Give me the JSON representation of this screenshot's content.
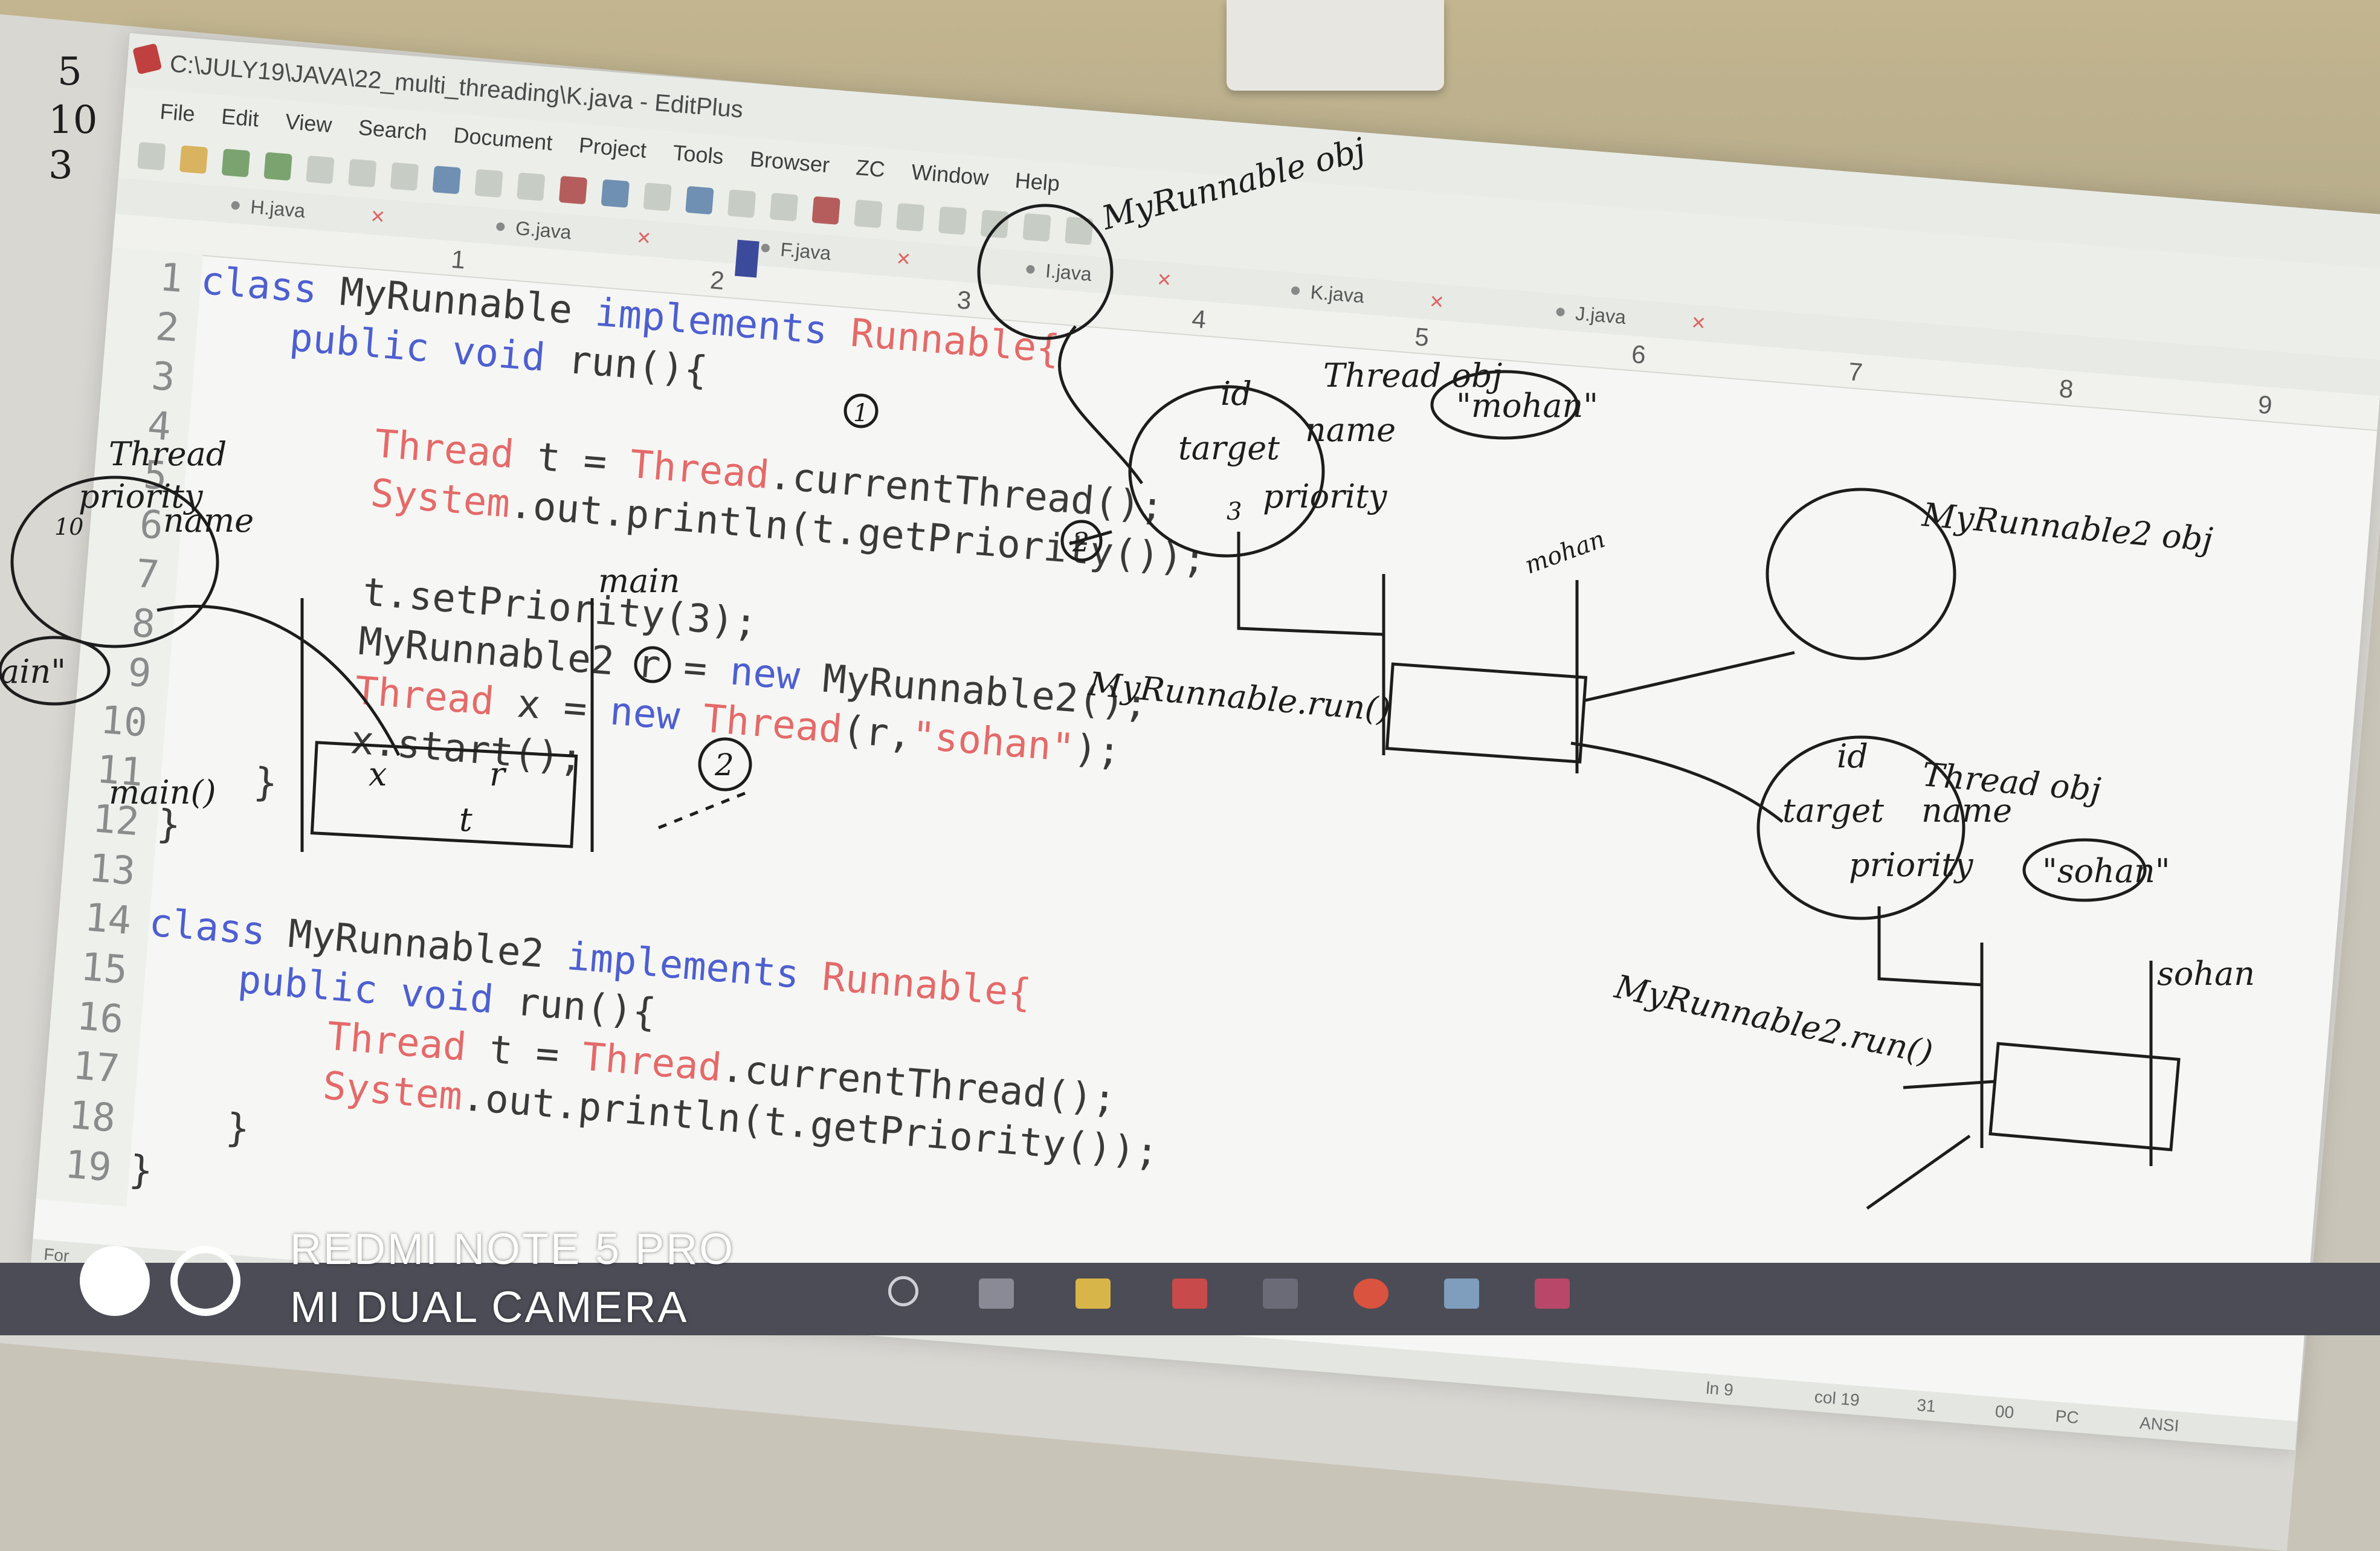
{
  "window": {
    "title": "C:\\JULY19\\JAVA\\22_multi_threading\\K.java - EditPlus"
  },
  "menu": {
    "items": [
      "File",
      "Edit",
      "View",
      "Search",
      "Document",
      "Project",
      "Tools",
      "Browser",
      "ZC",
      "Window",
      "Help"
    ]
  },
  "tabs": [
    "H.java",
    "G.java",
    "F.java",
    "I.java",
    "K.java",
    "J.java"
  ],
  "ruler": {
    "ticks": [
      "1",
      "2",
      "3",
      "4",
      "5",
      "6",
      "7",
      "8",
      "9"
    ]
  },
  "code": {
    "lines": [
      {
        "n": "1",
        "parts": [
          [
            "kw",
            "class "
          ],
          [
            "tx",
            "MyRunnable "
          ],
          [
            "kw",
            "implements "
          ],
          [
            "tp",
            "Runnable{"
          ]
        ]
      },
      {
        "n": "2",
        "parts": [
          [
            "kw",
            "    public void "
          ],
          [
            "tx",
            "run(){"
          ]
        ]
      },
      {
        "n": "3",
        "parts": []
      },
      {
        "n": "4",
        "parts": [
          [
            "tp",
            "        Thread "
          ],
          [
            "tx",
            "t = "
          ],
          [
            "tp",
            "Thread"
          ],
          [
            "tx",
            ".currentThread();"
          ]
        ]
      },
      {
        "n": "5",
        "parts": [
          [
            "tp",
            "        System"
          ],
          [
            "tx",
            ".out.println(t.getPriority());"
          ]
        ]
      },
      {
        "n": "6",
        "parts": []
      },
      {
        "n": "7",
        "parts": [
          [
            "tx",
            "        t.setPriority(3);"
          ]
        ]
      },
      {
        "n": "8",
        "parts": [
          [
            "tx",
            "        MyRunnable2 r = "
          ],
          [
            "kw",
            "new "
          ],
          [
            "tx",
            "MyRunnable2();"
          ]
        ]
      },
      {
        "n": "9",
        "parts": [
          [
            "tp",
            "        Thread "
          ],
          [
            "tx",
            "x = "
          ],
          [
            "kw",
            "new "
          ],
          [
            "tp",
            "Thread"
          ],
          [
            "tx",
            "(r,"
          ],
          [
            "tp",
            "\"sohan\""
          ],
          [
            "tx",
            ");"
          ]
        ]
      },
      {
        "n": "10",
        "parts": [
          [
            "tx",
            "        x.start();"
          ]
        ]
      },
      {
        "n": "11",
        "parts": [
          [
            "tx",
            "    }"
          ]
        ]
      },
      {
        "n": "12",
        "parts": [
          [
            "tx",
            "}"
          ]
        ]
      },
      {
        "n": "13",
        "parts": []
      },
      {
        "n": "14",
        "parts": [
          [
            "kw",
            "class "
          ],
          [
            "tx",
            "MyRunnable2 "
          ],
          [
            "kw",
            "implements "
          ],
          [
            "tp",
            "Runnable{"
          ]
        ]
      },
      {
        "n": "15",
        "parts": [
          [
            "kw",
            "    public void "
          ],
          [
            "tx",
            "run(){"
          ]
        ]
      },
      {
        "n": "16",
        "parts": [
          [
            "tp",
            "        Thread "
          ],
          [
            "tx",
            "t = "
          ],
          [
            "tp",
            "Thread"
          ],
          [
            "tx",
            ".currentThread();"
          ]
        ]
      },
      {
        "n": "17",
        "parts": [
          [
            "tp",
            "        System"
          ],
          [
            "tx",
            ".out.println(t.getPriority());"
          ]
        ]
      },
      {
        "n": "18",
        "parts": [
          [
            "tx",
            "    }"
          ]
        ]
      },
      {
        "n": "19",
        "parts": [
          [
            "tx",
            "}"
          ]
        ]
      }
    ]
  },
  "status": {
    "ln": "ln 9",
    "col": "col 19",
    "count": "31",
    "code": "00",
    "eol": "PC",
    "encoding": "ANSI",
    "help": "For"
  },
  "handwriting": {
    "margin_numbers": [
      "5",
      "10",
      "3"
    ],
    "labels": {
      "myrunnable_obj": "MyRunnable obj",
      "thread_obj_top": "Thread obj",
      "mohan": "\"mohan\"",
      "id": "id",
      "target": "target",
      "name_top": "name",
      "priority_top": "priority",
      "thread_left": "Thread",
      "priority_left": "priority",
      "name_left": "name",
      "main_quoted": "ain\"",
      "main_stack": "main",
      "main_call": "main()",
      "myrunnable_run": "MyRunnable.run()",
      "myrunnable2_obj": "MyRunnable2 obj",
      "thread_obj_bottom": "Thread obj",
      "name_bottom": "name",
      "priority_bottom": "priority",
      "sohan": "\"sohan\"",
      "sohan_stack": "sohan",
      "myrunnable2_run": "MyRunnable2.run()",
      "mohan_stack": "mohan",
      "x": "x",
      "r": "r",
      "t": "t",
      "circle_1": "1",
      "circle_2": "2",
      "circle_3": "3",
      "ten": "10"
    }
  },
  "watermark": {
    "line1": "REDMI NOTE 5 PRO",
    "line2": "MI DUAL CAMERA"
  }
}
